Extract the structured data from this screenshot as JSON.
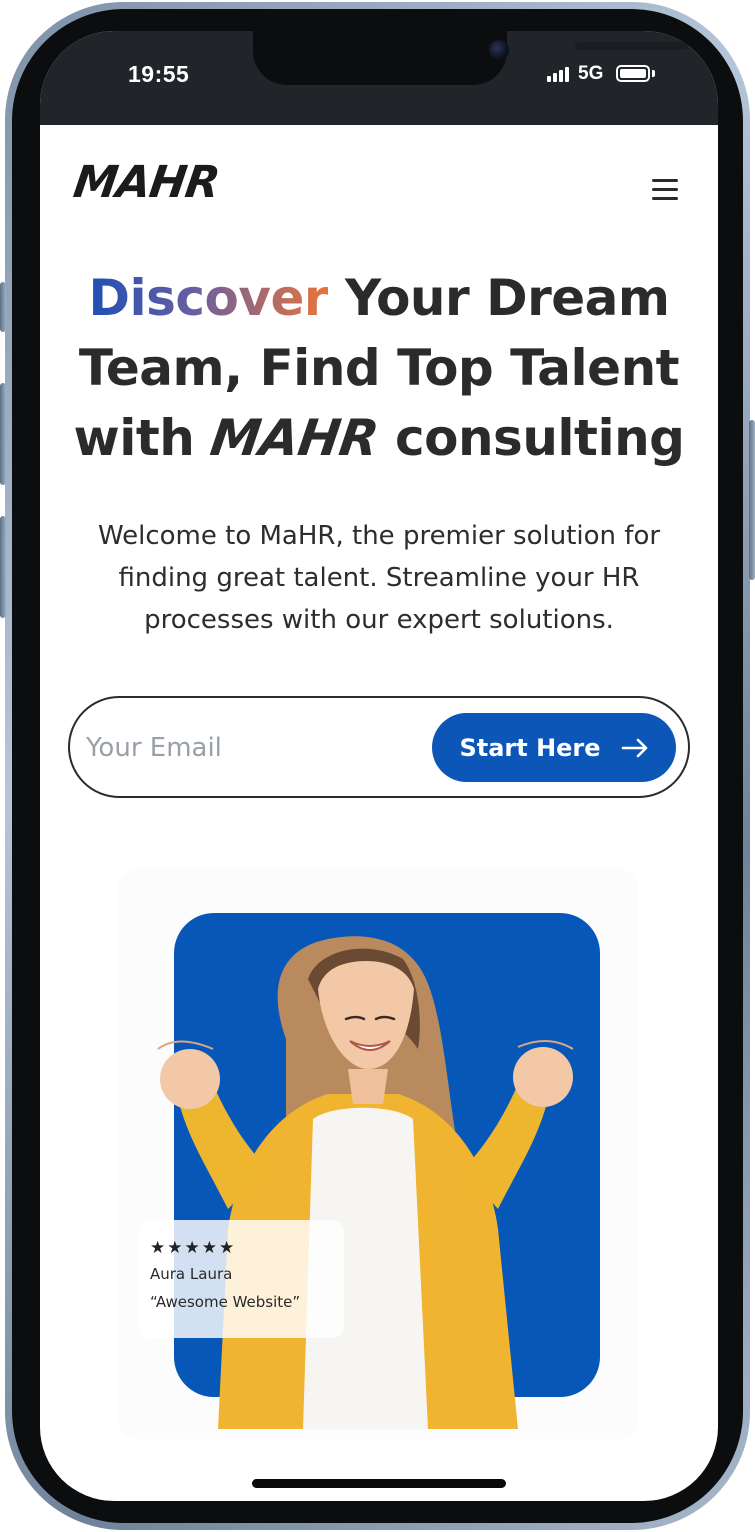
{
  "status_bar": {
    "time": "19:55",
    "network": "5G"
  },
  "header": {
    "logo_text": "MAHR",
    "menu_icon": "hamburger-menu-icon"
  },
  "hero": {
    "title_highlight": "Discover",
    "title_rest_1": " Your Dream Team, Find Top Talent with ",
    "title_logo": "MAHR",
    "title_rest_2": " consulting",
    "subtitle": "Welcome to MaHR, the premier solution for finding great talent. Streamline your HR processes with our expert solutions."
  },
  "email_form": {
    "placeholder": "Your Email",
    "value": "",
    "button_label": "Start Here",
    "button_icon": "arrow-right-icon"
  },
  "review": {
    "rating": 5,
    "stars": [
      "★",
      "★",
      "★",
      "★",
      "★"
    ],
    "reviewer": "Aura Laura",
    "quote": "“Awesome Website”"
  },
  "colors": {
    "brand_blue": "#0c56b8",
    "gradient_start": "#1f4fb4",
    "gradient_end": "#e9743a",
    "status_bar": "#212529",
    "text_dark": "#2b2b2b"
  }
}
